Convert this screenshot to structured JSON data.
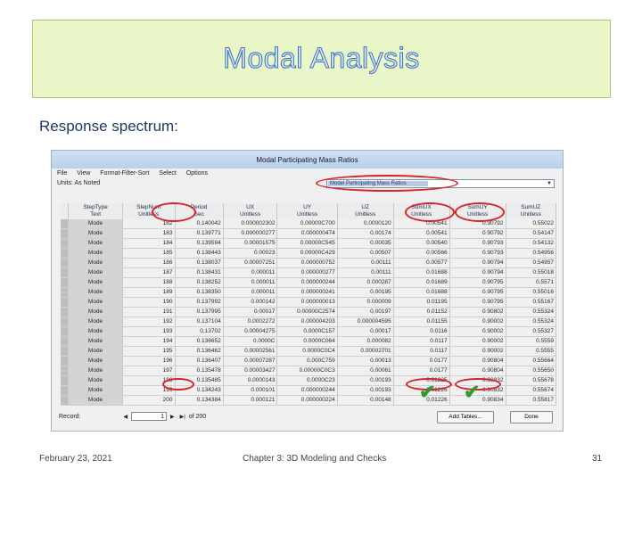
{
  "slide": {
    "title": "Modal Analysis",
    "subtitle": "Response spectrum:",
    "footer_date": "February 23, 2021",
    "footer_center": "Chapter 3: 3D Modeling and Checks",
    "page_number": "31"
  },
  "window": {
    "title": "Modal Participating Mass Ratios",
    "menu": [
      "File",
      "View",
      "Format-Filter-Sort",
      "Select",
      "Options"
    ],
    "units_label": "Units: As Noted",
    "table_select": "Model Participating Mass Ratios"
  },
  "table": {
    "headers": [
      [
        "StepType",
        "Text"
      ],
      [
        "StepNum",
        "Unitless"
      ],
      [
        "Period",
        "Sec"
      ],
      [
        "UX",
        "Unitless"
      ],
      [
        "UY",
        "Unitless"
      ],
      [
        "UZ",
        "Unitless"
      ],
      [
        "SumUX",
        "Unitless"
      ],
      [
        "SumUY",
        "Unitless"
      ],
      [
        "SumUZ",
        "Unitless"
      ]
    ],
    "rows": [
      [
        "Mode",
        "182",
        "0.140042",
        "0.000002302",
        "0.00000C700",
        "0.0000120",
        "0.00541",
        "0.90792",
        "0.55022"
      ],
      [
        "Mode",
        "183",
        "0.139771",
        "0.000000277",
        "0.000000474",
        "0.00174",
        "0.00541",
        "0.90792",
        "0.54147"
      ],
      [
        "Mode",
        "184",
        "0.139594",
        "0.00001575",
        "0.00000C545",
        "0.00035",
        "0.00540",
        "0.90793",
        "0.54132"
      ],
      [
        "Mode",
        "185",
        "0.138443",
        "0.00023",
        "0.00000C429",
        "0.00507",
        "0.00566",
        "0.90793",
        "0.54956"
      ],
      [
        "Mode",
        "186",
        "0.138037",
        "0.00007251",
        "0.000000752",
        "0.00111",
        "0.00577",
        "0.90794",
        "0.54957"
      ],
      [
        "Mode",
        "187",
        "0.138431",
        "0.000011",
        "0.000000277",
        "0.00111",
        "0.01688",
        "0.90794",
        "0.55018"
      ],
      [
        "Mode",
        "188",
        "0.138252",
        "0.000011",
        "0.000000244",
        "0.000287",
        "0.01689",
        "0.90795",
        "0.5571"
      ],
      [
        "Mode",
        "189",
        "0.138350",
        "0.000011",
        "0.000000241",
        "0.00195",
        "0.01688",
        "0.90795",
        "0.55016"
      ],
      [
        "Mode",
        "190",
        "0.137992",
        "0.000142",
        "0.000000013",
        "0.000009",
        "0.01195",
        "0.90795",
        "0.55167"
      ],
      [
        "Mode",
        "191",
        "0.137995",
        "0.00017",
        "0.00000C2574",
        "0.00197",
        "0.01152",
        "0.90802",
        "0.55324"
      ],
      [
        "Mode",
        "192",
        "0.137104",
        "0.0002272",
        "0.000004203",
        "0.000004595",
        "0.01155",
        "0.90002",
        "0.55324"
      ],
      [
        "Mode",
        "193",
        "0.13702",
        "0.00004275",
        "0.0000C157",
        "0.00017",
        "0.0116",
        "0.90002",
        "0.55327"
      ],
      [
        "Mode",
        "194",
        "0.136652",
        "0.0000C",
        "0.0000C064",
        "0.000082",
        "0.0117",
        "0.90002",
        "0.5559"
      ],
      [
        "Mode",
        "195",
        "0.136462",
        "0.00002561",
        "0.0000C0C4",
        "0.00002701",
        "0.0117",
        "0.90002",
        "0.5555"
      ],
      [
        "Mode",
        "196",
        "0.136407",
        "0.00007287",
        "0.000C759",
        "0.00013",
        "0.0177",
        "0.90804",
        "0.55664"
      ],
      [
        "Mode",
        "197",
        "0.135478",
        "0.00003427",
        "0.00000C0C3",
        "0.00061",
        "0.0177",
        "0.90804",
        "0.55650"
      ],
      [
        "Mode",
        "198",
        "0.135485",
        "0.0000143",
        "0.0000C23",
        "0.00193",
        "0.01225",
        "0.90832",
        "0.55678"
      ],
      [
        "Mode",
        "199",
        "0.134243",
        "0.000101",
        "0.000000244",
        "0.00193",
        "0.01226",
        "0.90832",
        "0.55674"
      ],
      [
        "Mode",
        "200",
        "0.134384",
        "0.000121",
        "0.000000224",
        "0.00148",
        "0.01226",
        "0.90834",
        "0.55817"
      ]
    ]
  },
  "record_bar": {
    "label": "Record:",
    "current": "1",
    "of_label": "of 200",
    "add_tables_label": "Add Tables...",
    "done_label": "Done"
  },
  "colors": {
    "title_fill": "#dce9f8",
    "title_stroke": "#3a6fb3",
    "subtitle": "#1f3864",
    "highlight_ring": "#d6242b",
    "checkmark": "#2e9b2e"
  },
  "icons": {
    "dropdown": "▼",
    "prev": "◀",
    "next": "▶",
    "last": "▶|",
    "check": "✔"
  }
}
